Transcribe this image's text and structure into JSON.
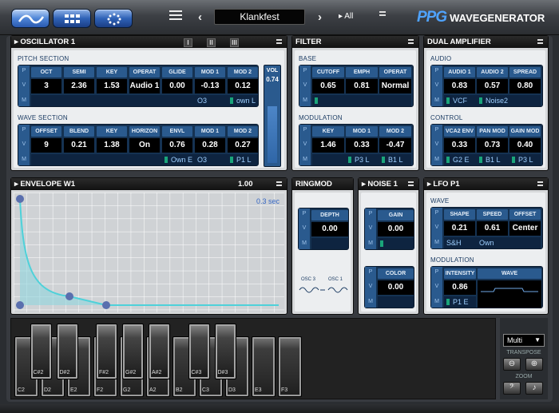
{
  "topbar": {
    "patch_name": "Klankfest",
    "patch_filter": "All",
    "brand_pps": "PPG",
    "brand_name": "WAVEGENERATOR"
  },
  "oscillator": {
    "title": "OSCILLATOR 1",
    "toggles": [
      "I",
      "II",
      "III"
    ],
    "pitch_label": "PITCH SECTION",
    "pitch_headers": [
      "OCT",
      "SEMI",
      "KEY",
      "OPERAT",
      "GLIDE",
      "MOD 1",
      "MOD 2"
    ],
    "pitch_values": [
      "3",
      "2.36",
      "1.53",
      "Audio 1",
      "0.00",
      "-0.13",
      "0.12"
    ],
    "pitch_mod": [
      "O3",
      "own L"
    ],
    "wave_label": "WAVE SECTION",
    "wave_headers": [
      "OFFSET",
      "BLEND",
      "KEY",
      "HORIZON",
      "ENVL",
      "MOD 1",
      "MOD 2"
    ],
    "wave_values": [
      "9",
      "0.21",
      "1.38",
      "On",
      "0.76",
      "0.28",
      "0.27"
    ],
    "wave_mod": [
      "Own E",
      "O3",
      "P1 L"
    ],
    "vol_label": "VOL",
    "vol_value": "0.74",
    "vol_level": 0.74
  },
  "filter": {
    "title": "FILTER",
    "base_label": "BASE",
    "base_headers": [
      "CUTOFF",
      "EMPH",
      "OPERAT"
    ],
    "base_values": [
      "0.65",
      "0.81",
      "Normal"
    ],
    "mod_label": "MODULATION",
    "mod_headers": [
      "KEY",
      "MOD 1",
      "MOD 2"
    ],
    "mod_values": [
      "1.46",
      "0.33",
      "-0.47"
    ],
    "mod_mod": [
      "P3 L",
      "B1 L"
    ]
  },
  "amp": {
    "title": "DUAL AMPLIFIER",
    "audio_label": "AUDIO",
    "audio_headers": [
      "AUDIO 1",
      "AUDIO 2",
      "SPREAD"
    ],
    "audio_values": [
      "0.83",
      "0.57",
      "0.80"
    ],
    "audio_mod": [
      "VCF",
      "Noise2"
    ],
    "control_label": "CONTROL",
    "control_headers": [
      "VCA2 ENV",
      "PAN MOD",
      "GAIN MOD"
    ],
    "control_values": [
      "0.33",
      "0.73",
      "0.40"
    ],
    "control_mod": [
      "G2 E",
      "B1 L",
      "P3 L"
    ]
  },
  "envelope": {
    "title": "ENVELOPE W1",
    "value": "1.00",
    "time": "0.3 sec"
  },
  "ringmod": {
    "title": "RINGMOD",
    "depth_label": "DEPTH",
    "depth_value": "0.00",
    "osc_a": "OSC 3",
    "osc_b": "OSC 1"
  },
  "noise": {
    "title": "NOISE 1",
    "gain_label": "GAIN",
    "gain_value": "0.00",
    "color_label": "COLOR",
    "color_value": "0.00"
  },
  "lfo": {
    "title": "LFO P1",
    "wave_label": "WAVE",
    "wave_headers": [
      "SHAPE",
      "SPEED",
      "OFFSET"
    ],
    "wave_values": [
      "0.21",
      "0.61",
      "Center"
    ],
    "wave_mod": [
      "S&H",
      "Own"
    ],
    "mod_label": "MODULATION",
    "mod_headers": [
      "INTENSITY",
      "WAVE"
    ],
    "intensity_value": "0.86",
    "intensity_mod": "P1 E"
  },
  "keyboard": {
    "white_keys": [
      "C2",
      "D2",
      "E2",
      "F2",
      "G2",
      "A2",
      "B2",
      "C3",
      "D3",
      "E3",
      "F3"
    ],
    "black_keys": [
      "C#2",
      "D#2",
      "F#2",
      "G#2",
      "A#2",
      "C#3",
      "D#3"
    ],
    "mode": "Multi",
    "transpose_label": "TRANSPOSE",
    "zoom_label": "ZOOM"
  },
  "pvm": [
    "P",
    "V",
    "M"
  ]
}
